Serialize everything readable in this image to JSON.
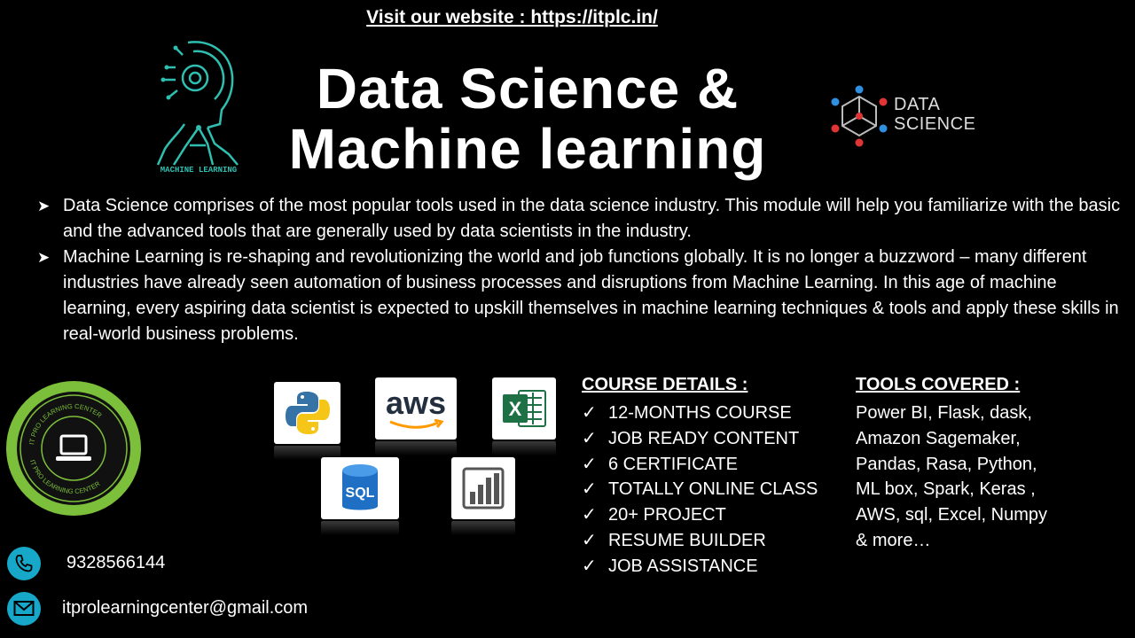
{
  "header": {
    "website_line": "Visit our website : https://itplc.in/",
    "title_line1": "Data Science &",
    "title_line2": "Machine learning"
  },
  "logos": {
    "left_logo_caption": "MACHINE LEARNING",
    "right_logo_line1": "DATA",
    "right_logo_line2": "SCIENCE"
  },
  "bullets": [
    "Data Science comprises of the most popular tools used in the data science industry. This module will help you familiarize with the basic and the advanced tools that are generally used by data scientists in the industry.",
    "Machine Learning is re-shaping and revolutionizing the world and job functions globally. It is no longer a buzzword – many different industries have already seen automation of business processes and disruptions from Machine Learning. In this age of machine learning, every aspiring data scientist is expected to upskill themselves in machine learning techniques & tools and apply these skills in real-world business problems."
  ],
  "badge": {
    "ring_text": "IT PRO LEARNING CENTER"
  },
  "tool_tiles": {
    "aws_label": "aws",
    "excel_label": "X",
    "sql_label": "SQL"
  },
  "course_details": {
    "heading": "COURSE DETAILS :",
    "items": [
      "12-MONTHS COURSE",
      "JOB READY CONTENT",
      "6 CERTIFICATE",
      "TOTALLY ONLINE CLASS",
      "20+ PROJECT",
      "RESUME BUILDER",
      "JOB ASSISTANCE"
    ]
  },
  "tools_covered": {
    "heading": "TOOLS COVERED :",
    "text": "Power BI, Flask, dask, Amazon Sagemaker, Pandas, Rasa, Python, ML box, Spark, Keras , AWS, sql, Excel, Numpy & more…"
  },
  "contact": {
    "phone": "9328566144",
    "email": "itprolearningcenter@gmail.com"
  },
  "colors": {
    "background": "#000000",
    "text": "#ffffff",
    "badge_green": "#7cbf3a",
    "contact_icon": "#17a8c9",
    "ml_logo": "#2fbfb0"
  },
  "icons": [
    "ml-head-logo",
    "data-science-logo",
    "laptop-icon",
    "python-icon",
    "aws-icon",
    "excel-icon",
    "sql-icon",
    "powerbi-icon",
    "phone-icon",
    "email-icon",
    "check-icon",
    "arrow-bullet-icon"
  ]
}
